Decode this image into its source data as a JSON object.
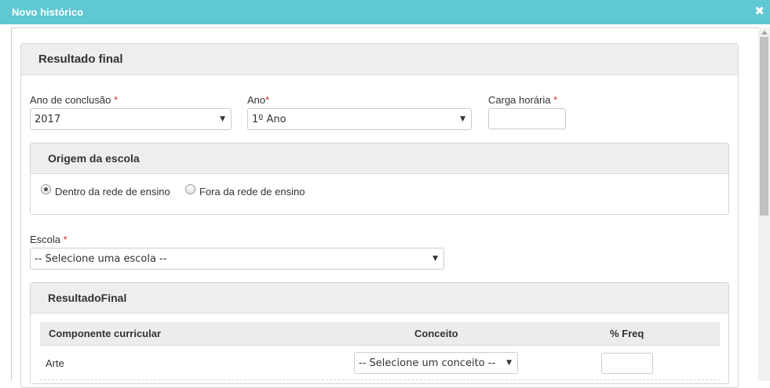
{
  "dialog": {
    "title": "Novo histórico",
    "close_glyph": "✖"
  },
  "main_panel": {
    "title": "Resultado final"
  },
  "fields": {
    "ano_conclusao": {
      "label": "Ano de conclusão",
      "required_mark": "*",
      "value": "2017"
    },
    "ano": {
      "label": "Ano",
      "required_mark": "*",
      "value": "1º Ano"
    },
    "carga_horaria": {
      "label": "Carga horária",
      "required_mark": "*",
      "value": ""
    },
    "escola": {
      "label": "Escola",
      "required_mark": "*",
      "value": "-- Selecione uma escola --"
    }
  },
  "origem_panel": {
    "title": "Origem da escola",
    "options": [
      {
        "label": "Dentro da rede de ensino",
        "checked": true
      },
      {
        "label": "Fora da rede de ensino",
        "checked": false
      }
    ]
  },
  "resultado_panel": {
    "title": "ResultadoFinal",
    "columns": [
      "Componente curricular",
      "Conceito",
      "% Freq"
    ],
    "rows": [
      {
        "componente": "Arte",
        "conceito": "-- Selecione um conceito --",
        "freq": ""
      }
    ]
  },
  "icons": {
    "dropdown": "chevron-down-icon",
    "close": "close-icon"
  }
}
